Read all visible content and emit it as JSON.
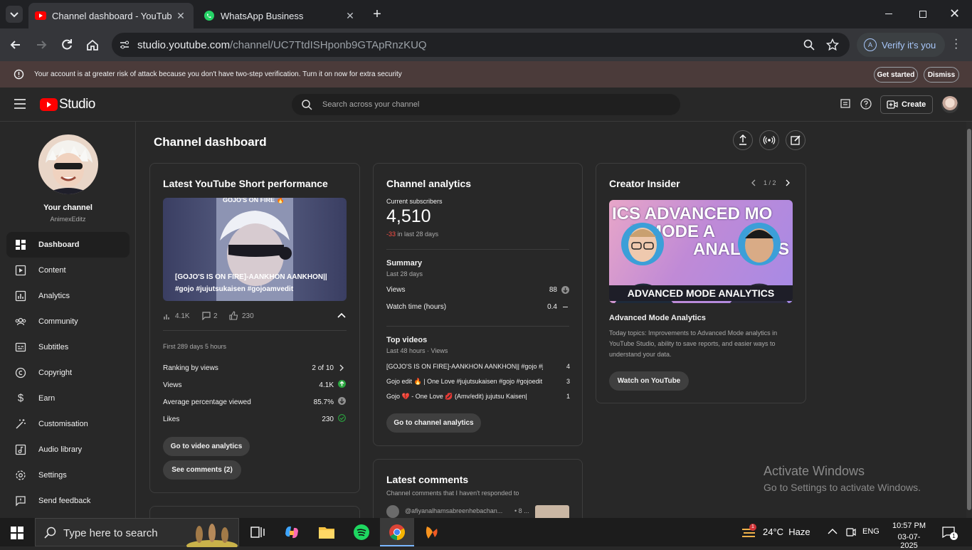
{
  "browser": {
    "tabs": [
      {
        "label": "Channel dashboard - YouTube Studio",
        "active": true
      },
      {
        "label": "WhatsApp Business",
        "active": false
      }
    ],
    "url_host": "studio.youtube.com",
    "url_path": "/channel/UC7TtdISHponb9GTApRnzKUQ",
    "verify_label": "Verify it's you",
    "warning": {
      "message": "Your account is at greater risk of attack because you don't have two-step verification. Turn it on now for extra security",
      "get_started": "Get started",
      "dismiss": "Dismiss"
    }
  },
  "studio": {
    "logo_text": "Studio",
    "search_placeholder": "Search across your channel",
    "create_label": "Create"
  },
  "sidebar": {
    "your_channel": "Your channel",
    "channel_name": "AnimexEditz",
    "items": [
      {
        "label": "Dashboard",
        "icon": "dashboard-icon"
      },
      {
        "label": "Content",
        "icon": "content-icon"
      },
      {
        "label": "Analytics",
        "icon": "analytics-icon"
      },
      {
        "label": "Community",
        "icon": "community-icon"
      },
      {
        "label": "Subtitles",
        "icon": "subtitles-icon"
      },
      {
        "label": "Copyright",
        "icon": "copyright-icon"
      },
      {
        "label": "Earn",
        "icon": "earn-icon"
      },
      {
        "label": "Customisation",
        "icon": "customisation-icon"
      },
      {
        "label": "Audio library",
        "icon": "audio-library-icon"
      },
      {
        "label": "Settings",
        "icon": "settings-icon"
      },
      {
        "label": "Send feedback",
        "icon": "feedback-icon"
      }
    ]
  },
  "dashboard": {
    "title": "Channel dashboard",
    "short_card": {
      "title": "Latest YouTube Short performance",
      "thumb_top": "GOJO'S ON FIRE 🔥",
      "thumb_caption": "[GOJO'S IS ON FIRE]-AANKHON AANKHON|| #gojo #jujutsukaisen #gojoamvedit",
      "views_count": "4.1K",
      "comments_count": "2",
      "likes_count": "230",
      "period": "First 289 days 5 hours",
      "rows": [
        {
          "label": "Ranking by views",
          "value": "2 of 10"
        },
        {
          "label": "Views",
          "value": "4.1K"
        },
        {
          "label": "Average percentage viewed",
          "value": "85.7%"
        },
        {
          "label": "Likes",
          "value": "230"
        }
      ],
      "btn_analytics": "Go to video analytics",
      "btn_comments": "See comments (2)"
    },
    "analytics_card": {
      "title": "Channel analytics",
      "subs_label": "Current subscribers",
      "subs_value": "4,510",
      "subs_delta": "-33",
      "subs_delta_suffix": "in last 28 days",
      "summary_title": "Summary",
      "summary_period": "Last 28 days",
      "summary_rows": [
        {
          "label": "Views",
          "value": "88"
        },
        {
          "label": "Watch time (hours)",
          "value": "0.4"
        }
      ],
      "top_title": "Top videos",
      "top_period": "Last 48 hours · Views",
      "top_videos": [
        {
          "title": "[GOJO'S IS ON FIRE]-AANKHON AANKHON|| #gojo #juj...",
          "views": "4"
        },
        {
          "title": "Gojo edit 🔥 | One Love #jujutsukaisen #gojo #gojoedit ...",
          "views": "3"
        },
        {
          "title": "Gojo 💔 - One Love 💋 (Amv/edit) jujutsu Kaisen|",
          "views": "1"
        }
      ],
      "btn": "Go to channel analytics"
    },
    "comments_card": {
      "title": "Latest comments",
      "subtitle": "Channel comments that I haven't responded to",
      "first_user": "@afiyanalhamsabreenhebachan...",
      "first_time": "• 8 ..."
    },
    "creator_card": {
      "title": "Creator Insider",
      "pager": "1 / 2",
      "thumb_top": "ICS ADVANCED MO",
      "thumb_mid": "D MODE A",
      "thumb_low": "ANALYTICS",
      "thumb_banner": "ADVANCED MODE ANALYTICS",
      "video_title": "Advanced Mode Analytics",
      "description": "Today topics: Improvements to Advanced Mode analytics in YouTube Studio, ability to save reports, and easier ways to understand your data.",
      "btn": "Watch on YouTube"
    }
  },
  "watermark": {
    "line1": "Activate Windows",
    "line2": "Go to Settings to activate Windows."
  },
  "taskbar": {
    "search_placeholder": "Type here to search",
    "weather": "24°C  Haze",
    "weather_badge": "1",
    "lang": "ENG",
    "time": "10:57 PM",
    "date": "03-07-2025",
    "notif_count": "1"
  }
}
